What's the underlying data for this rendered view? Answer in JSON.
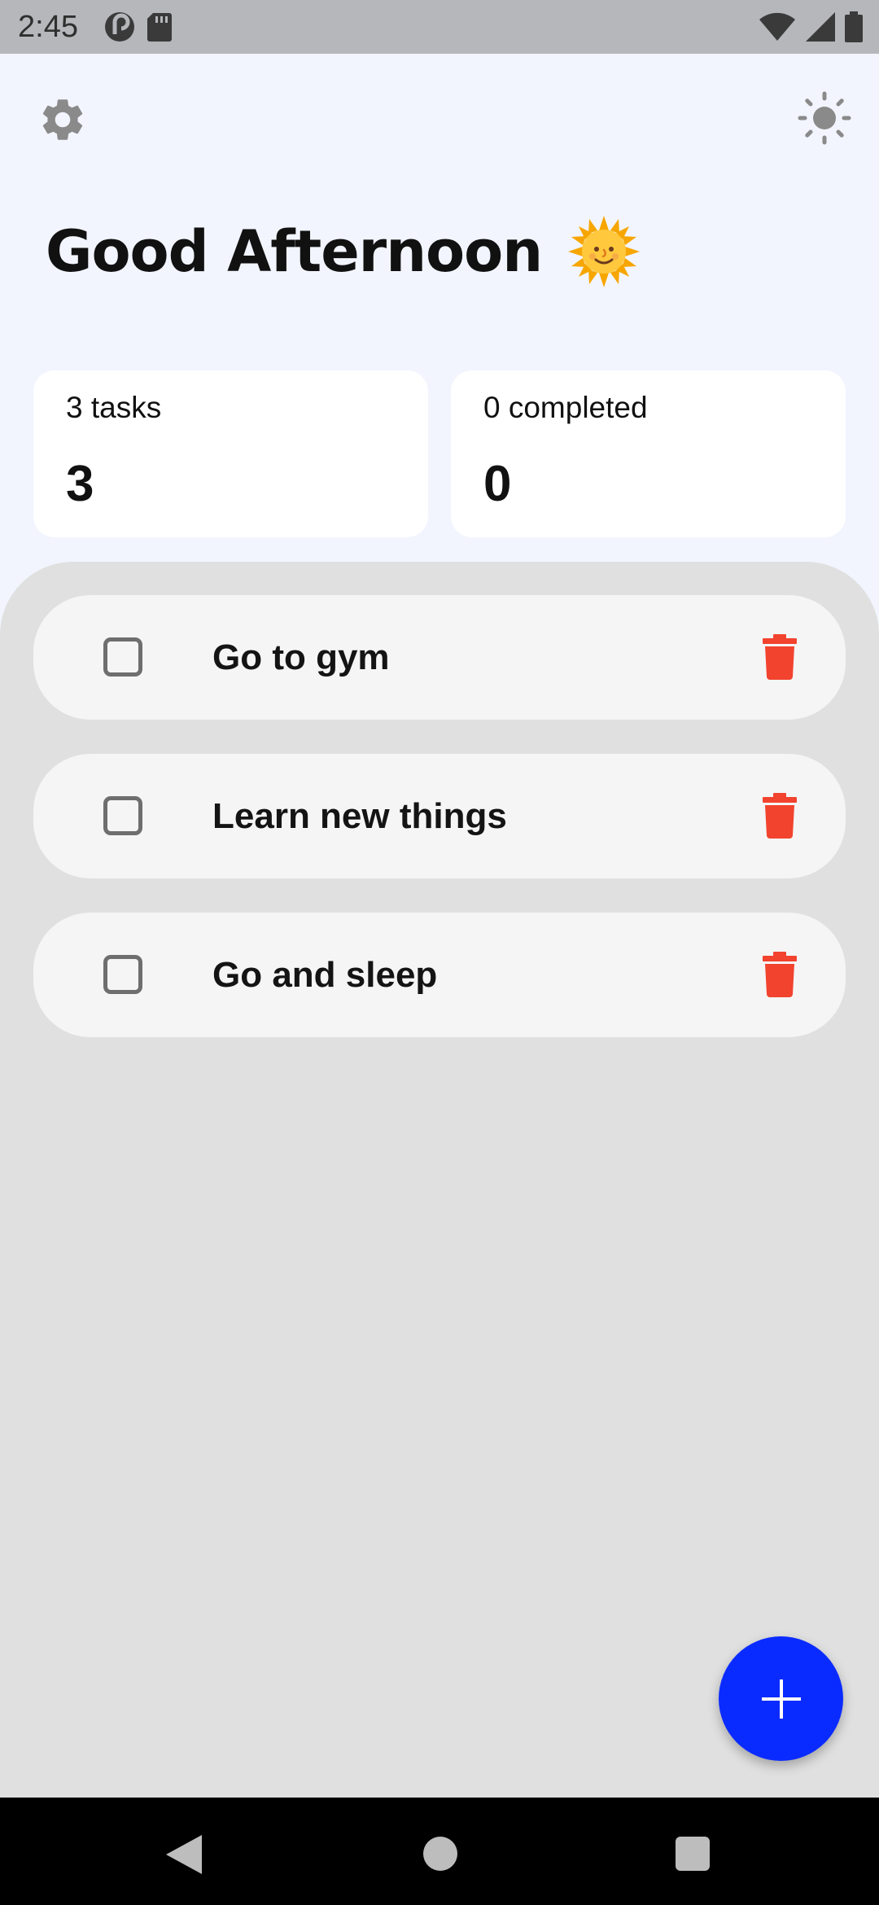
{
  "status_bar": {
    "time": "2:45",
    "icons": [
      "pocket-casts-icon",
      "sd-card-icon",
      "wifi-icon",
      "cell-signal-icon",
      "battery-icon"
    ]
  },
  "header": {
    "settings_icon": "gear-icon",
    "theme_icon": "sun-outline-icon",
    "greeting": "Good Afternoon",
    "greeting_emoji": "sun-with-face-emoji"
  },
  "stats": {
    "tasks": {
      "label": "3 tasks",
      "value": "3"
    },
    "completed": {
      "label": "0 completed",
      "value": "0"
    }
  },
  "tasks": [
    {
      "label": "Go to gym",
      "completed": false
    },
    {
      "label": "Learn new things",
      "completed": false
    },
    {
      "label": "Go and sleep",
      "completed": false
    }
  ],
  "fab": {
    "icon": "plus-icon"
  },
  "nav_bar": {
    "icons": [
      "back-icon",
      "home-icon",
      "recents-icon"
    ]
  },
  "colors": {
    "background": "#F2F5FE",
    "panel": "#E0E0E0",
    "card": "#FFFFFF",
    "task_card": "#F5F5F5",
    "delete": "#F2432F",
    "fab": "#0A2BFF",
    "icon_gray": "#8A8A8A"
  }
}
